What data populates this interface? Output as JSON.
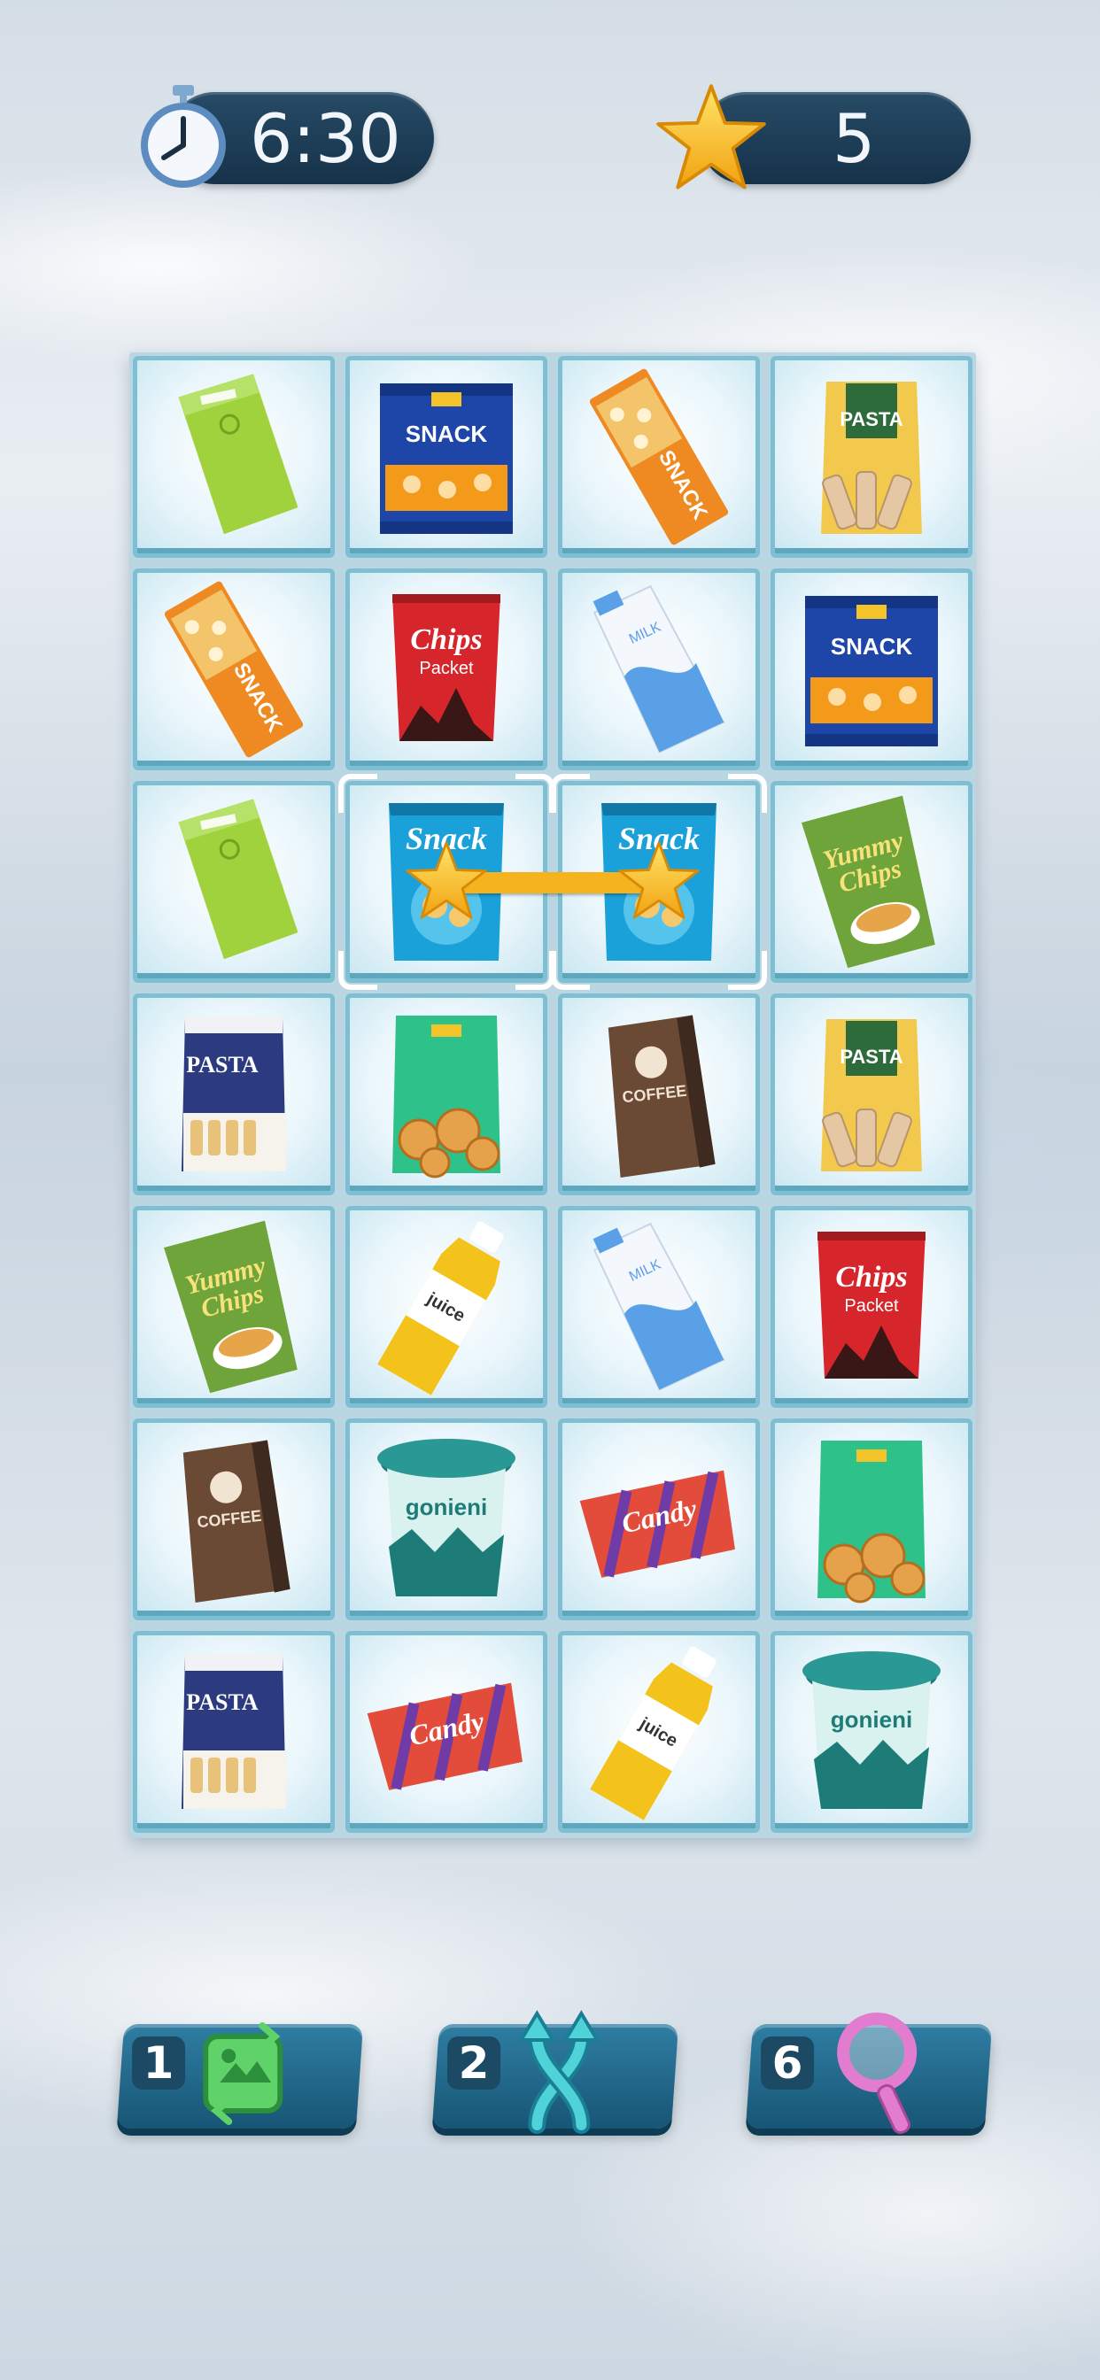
{
  "hud": {
    "timer": "6:30",
    "score": "5"
  },
  "board": {
    "columns": 4,
    "rows": 7,
    "tiles": [
      [
        "green-coffee-bag",
        "snack-bag-blue",
        "nut-bar-orange",
        "pasta-bag-yellow"
      ],
      [
        "nut-bar-orange",
        "chips-packet-red",
        "milk-carton",
        "snack-bag-blue"
      ],
      [
        "green-coffee-bag",
        "snack-bag-cyan",
        "snack-bag-cyan",
        "yummy-chips-green"
      ],
      [
        "pasta-bag-navy",
        "cookie-bag-green",
        "coffee-bag-brown",
        "pasta-bag-yellow"
      ],
      [
        "yummy-chips-green",
        "juice-bottle",
        "milk-carton",
        "chips-packet-red"
      ],
      [
        "coffee-bag-brown",
        "gonieni-cup",
        "candy-bar",
        "cookie-bag-green"
      ],
      [
        "pasta-bag-navy",
        "candy-bar",
        "juice-bottle",
        "gonieni-cup"
      ]
    ],
    "selected": [
      [
        2,
        1
      ],
      [
        2,
        2
      ]
    ]
  },
  "labels": {
    "snack": "SNACK",
    "pasta": "PASTA",
    "chips": "Chips",
    "packet": "Packet",
    "milk": "MILK",
    "snack_script": "Snack",
    "yummy": "Yummy",
    "yummy2": "Chips",
    "coffee": "COFFEE",
    "juice": "juice",
    "candy": "Candy",
    "gonieni": "gonieni"
  },
  "boosters": [
    {
      "name": "shuffle",
      "count": "1",
      "icon": "shuffle-icon",
      "color": "#5fd36a"
    },
    {
      "name": "swap",
      "count": "2",
      "icon": "swap-arrows-icon",
      "color": "#4fd3d9"
    },
    {
      "name": "hint",
      "count": "6",
      "icon": "magnifier-icon",
      "color": "#e27ccf"
    }
  ]
}
